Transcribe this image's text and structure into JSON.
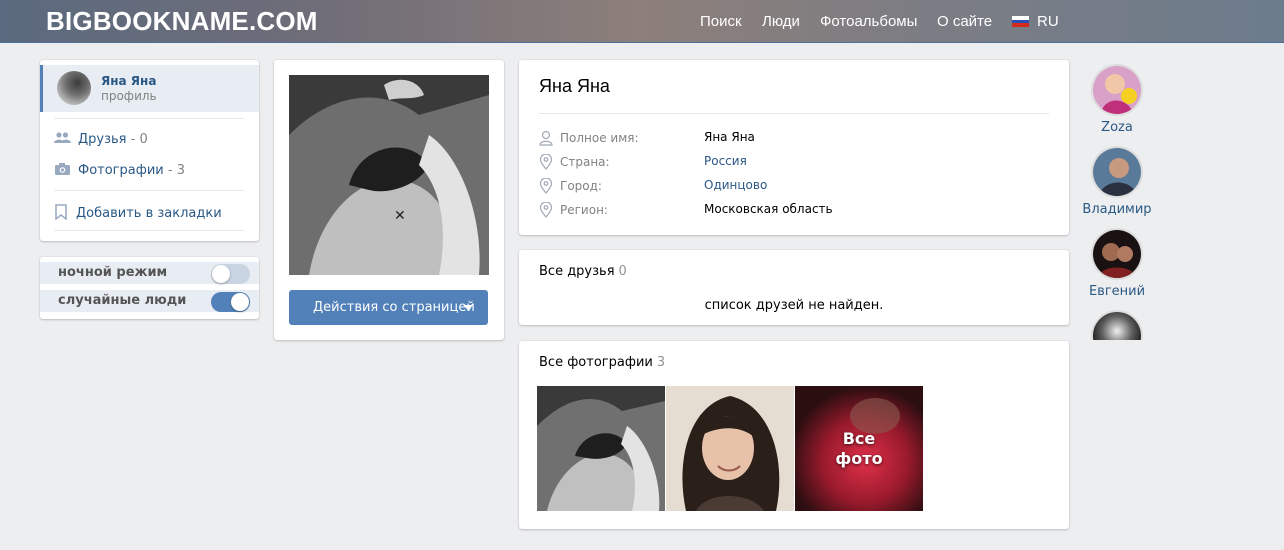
{
  "header": {
    "logo": "BIGBOOKNAME.COM",
    "nav": [
      "Поиск",
      "Люди",
      "Фотоальбомы",
      "О сайте"
    ],
    "lang": "RU"
  },
  "menu": {
    "user_name": "Яна Яна",
    "user_sub": "профиль",
    "friends_label": "Друзья",
    "friends_count": "- 0",
    "photos_label": "Фотографии",
    "photos_count": "- 3",
    "bookmark_label": "Добавить в закладки"
  },
  "settings": {
    "night_mode": "ночной режим",
    "night_mode_on": false,
    "random_people": "случайные люди",
    "random_people_on": true
  },
  "avatar_card": {
    "action_button": "Действия со страницей"
  },
  "profile": {
    "name": "Яна Яна",
    "rows": [
      {
        "label": "Полное имя:",
        "value": "Яна Яна"
      },
      {
        "label": "Страна:",
        "value": "Россия"
      },
      {
        "label": "Город:",
        "value": "Одинцово"
      },
      {
        "label": "Регион:",
        "value": "Московская область"
      }
    ]
  },
  "friends": {
    "title": "Все друзья",
    "count": "0",
    "empty": "список друзей не найден."
  },
  "photos": {
    "title": "Все фотографии",
    "count": "3",
    "all_label_1": "Все",
    "all_label_2": "фото"
  },
  "side_users": [
    {
      "name": "Zoza"
    },
    {
      "name": "Владимир"
    },
    {
      "name": "Евгений"
    }
  ],
  "colors": {
    "accent": "#5181b8",
    "link": "#2a5885",
    "background": "#edeef0"
  }
}
